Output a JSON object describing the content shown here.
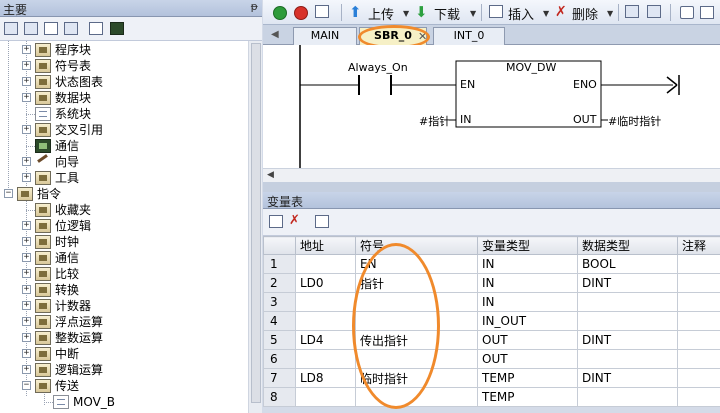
{
  "left_panel": {
    "title": "主要",
    "pin": "ᵽ",
    "tree": [
      {
        "label": "程序块",
        "expand": "+"
      },
      {
        "label": "符号表",
        "expand": "+"
      },
      {
        "label": "状态图表",
        "expand": "+"
      },
      {
        "label": "数据块",
        "expand": "+"
      },
      {
        "label": "系统块",
        "expand": ""
      },
      {
        "label": "交叉引用",
        "expand": "+"
      },
      {
        "label": "通信",
        "expand": ""
      },
      {
        "label": "向导",
        "expand": "+"
      },
      {
        "label": "工具",
        "expand": "+"
      },
      {
        "label": "指令",
        "expand": "−"
      },
      {
        "label": "收藏夹",
        "expand": ""
      },
      {
        "label": "位逻辑",
        "expand": "+"
      },
      {
        "label": "时钟",
        "expand": "+"
      },
      {
        "label": "通信",
        "expand": "+"
      },
      {
        "label": "比较",
        "expand": "+"
      },
      {
        "label": "转换",
        "expand": "+"
      },
      {
        "label": "计数器",
        "expand": "+"
      },
      {
        "label": "浮点运算",
        "expand": "+"
      },
      {
        "label": "整数运算",
        "expand": "+"
      },
      {
        "label": "中断",
        "expand": "+"
      },
      {
        "label": "逻辑运算",
        "expand": "+"
      },
      {
        "label": "传送",
        "expand": "−"
      },
      {
        "label": "MOV_B",
        "expand": ""
      }
    ]
  },
  "toolbar": {
    "upload": "上传",
    "download": "下载",
    "insert": "插入",
    "delete": "删除"
  },
  "tabs": {
    "main": "MAIN",
    "sbr": "SBR_0",
    "int": "INT_0"
  },
  "ladder": {
    "contact": "Always_On",
    "box": "MOV_DW",
    "en": "EN",
    "eno": "ENO",
    "in": "IN",
    "out": "OUT",
    "in_var": "#指针",
    "out_var": "#临时指针"
  },
  "var_table": {
    "title": "变量表",
    "columns": [
      "",
      "地址",
      "符号",
      "变量类型",
      "数据类型",
      "注释"
    ],
    "rows": [
      [
        "1",
        "",
        "EN",
        "IN",
        "BOOL",
        ""
      ],
      [
        "2",
        "LD0",
        "指针",
        "IN",
        "DINT",
        ""
      ],
      [
        "3",
        "",
        "",
        "IN",
        "",
        ""
      ],
      [
        "4",
        "",
        "",
        "IN_OUT",
        "",
        ""
      ],
      [
        "5",
        "LD4",
        "传出指针",
        "OUT",
        "DINT",
        ""
      ],
      [
        "6",
        "",
        "",
        "OUT",
        "",
        ""
      ],
      [
        "7",
        "LD8",
        "临时指针",
        "TEMP",
        "DINT",
        ""
      ],
      [
        "8",
        "",
        "",
        "TEMP",
        "",
        ""
      ]
    ]
  },
  "colors": {
    "annotation": "#f08a2c",
    "tab_active": "#f6f0c6"
  }
}
